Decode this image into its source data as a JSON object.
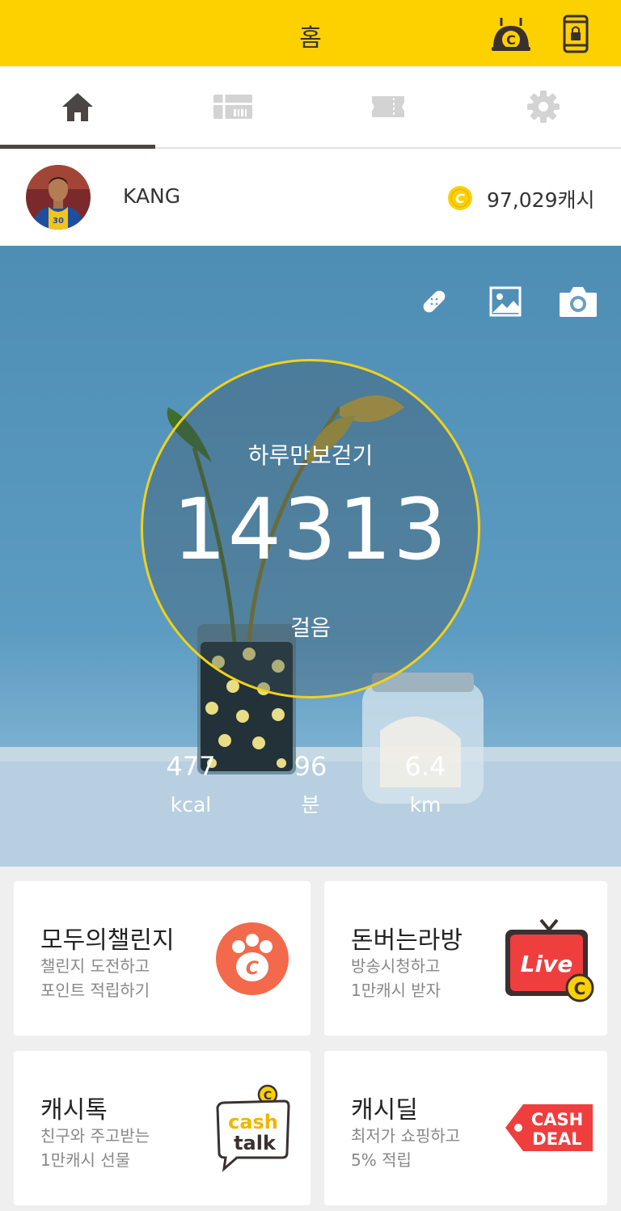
{
  "topbar": {
    "title": "홈",
    "icons": [
      "cash-robot-icon",
      "phone-lock-icon"
    ],
    "color": "#fdd000"
  },
  "tabs": [
    {
      "icon": "home-icon",
      "active": true
    },
    {
      "icon": "gift-card-icon",
      "active": false
    },
    {
      "icon": "ticket-icon",
      "active": false
    },
    {
      "icon": "settings-gear-icon",
      "active": false
    }
  ],
  "profile": {
    "username": "KANG",
    "cash_amount": "97,029캐시",
    "coin_glyph": "C"
  },
  "hero": {
    "tools": [
      "bandage-icon",
      "image-icon",
      "camera-icon"
    ],
    "label": "하루만보걷기",
    "steps": "14313",
    "steps_unit": "걸음",
    "progress": 1.0,
    "stats": [
      {
        "value": "477",
        "unit": "kcal"
      },
      {
        "value": "96",
        "unit": "분"
      },
      {
        "value": "6.4",
        "unit": "km"
      }
    ]
  },
  "cards": [
    {
      "title": "모두의챌린지",
      "line1": "챌린지 도전하고",
      "line2": "포인트 적립하기",
      "icon": "paw-coin-icon"
    },
    {
      "title": "돈버는라방",
      "line1": "방송시청하고",
      "line2": "1만캐시 받자",
      "icon": "live-tv-icon",
      "badge": "Live"
    },
    {
      "title": "캐시톡",
      "line1": "친구와 주고받는",
      "line2": "1만캐시 선물",
      "icon": "cashtalk-icon",
      "logo_text": [
        "cash",
        "talk"
      ]
    },
    {
      "title": "캐시딜",
      "line1": "최저가 쇼핑하고",
      "line2": "5% 적립",
      "icon": "cashdeal-tag-icon",
      "logo_text": [
        "CASH",
        "DEAL"
      ]
    }
  ]
}
